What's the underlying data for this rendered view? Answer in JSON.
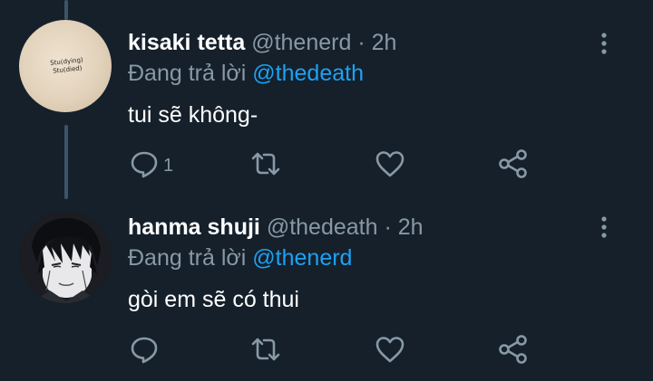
{
  "tweets": [
    {
      "display_name": "kisaki tetta",
      "handle": "@thenerd",
      "separator": "·",
      "time": "2h",
      "reply_prefix": "Đang trả lời",
      "reply_to": "@thedeath",
      "text": "tui sẽ không-",
      "reply_count": "1",
      "avatar_caption": "Stu(dying)\nStu(died)"
    },
    {
      "display_name": "hanma shuji",
      "handle": "@thedeath",
      "separator": "·",
      "time": "2h",
      "reply_prefix": "Đang trả lời",
      "reply_to": "@thenerd",
      "text": "gòi em sẽ có thui",
      "reply_count": ""
    }
  ],
  "icons": [
    "more-vertical-icon",
    "reply-icon",
    "retweet-icon",
    "like-icon",
    "share-icon"
  ],
  "colors": {
    "background": "#15202b",
    "text": "#ffffff",
    "secondary": "#8899a6",
    "mention": "#1da1f2",
    "thread_line": "#3d5466"
  }
}
